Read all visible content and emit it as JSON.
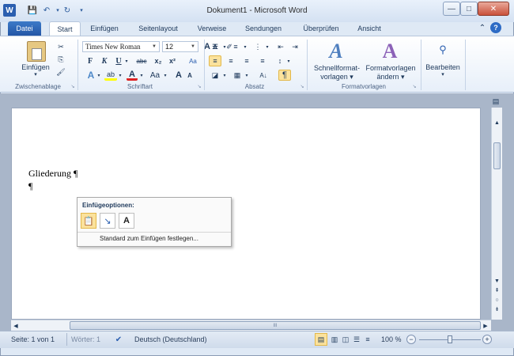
{
  "title_bar": {
    "title": "Dokument1 - Microsoft Word",
    "app_badge": "W",
    "qat_save": "💾",
    "qat_undo": "↶",
    "qat_redo": "↻",
    "qat_more": "▾",
    "min": "—",
    "max": "□",
    "close": "✕"
  },
  "tabs": [
    "Datei",
    "Start",
    "Einfügen",
    "Seitenlayout",
    "Verweise",
    "Sendungen",
    "Überprüfen",
    "Ansicht"
  ],
  "ribbon_right": {
    "up_icon": "⌃",
    "help": "?"
  },
  "clipboard": {
    "paste": "Einfügen",
    "paste_arrow": "▾",
    "cut": "✂",
    "copy": "⎘",
    "format": "🖌",
    "label": "Zwischenablage"
  },
  "font": {
    "name": "Times New Roman",
    "size": "12",
    "grow": "A",
    "shrink": "A",
    "clear": "✐",
    "bold": "F",
    "italic": "K",
    "underline": "U",
    "strike": "abc",
    "sub": "x₂",
    "sup": "x²",
    "aa": "Aa",
    "label": "Schriftart"
  },
  "paragraph": {
    "pilcrow": "¶",
    "sort": "A↓",
    "label": "Absatz"
  },
  "styles": {
    "quick": [
      "Schnellformat-",
      "vorlagen ▾"
    ],
    "change": [
      "Formatvorlagen",
      "ändern ▾"
    ],
    "label": "Formatvorlagen"
  },
  "editing": {
    "label": "Bearbeiten",
    "arrow": "▾"
  },
  "document": {
    "line1": "Gliederung ¶",
    "line2": "¶"
  },
  "paste_popup": {
    "title": "Einfügeoptionen:",
    "option_text": "A",
    "link": "Standard zum Einfügen festlegen..."
  },
  "statusbar": {
    "page": "Seite: 1 von 1",
    "words": "Wörter: 1",
    "language": "Deutsch (Deutschland)",
    "zoom": "100 %",
    "zoom_minus": "−",
    "zoom_plus": "+"
  },
  "scroll": {
    "up": "▲",
    "down": "▼",
    "left": "◀",
    "right": "▶",
    "grip": "III"
  },
  "colors": {
    "accent": "#2b579a",
    "file_tab": "#2a5caa",
    "highlight": "#fbe29c"
  }
}
